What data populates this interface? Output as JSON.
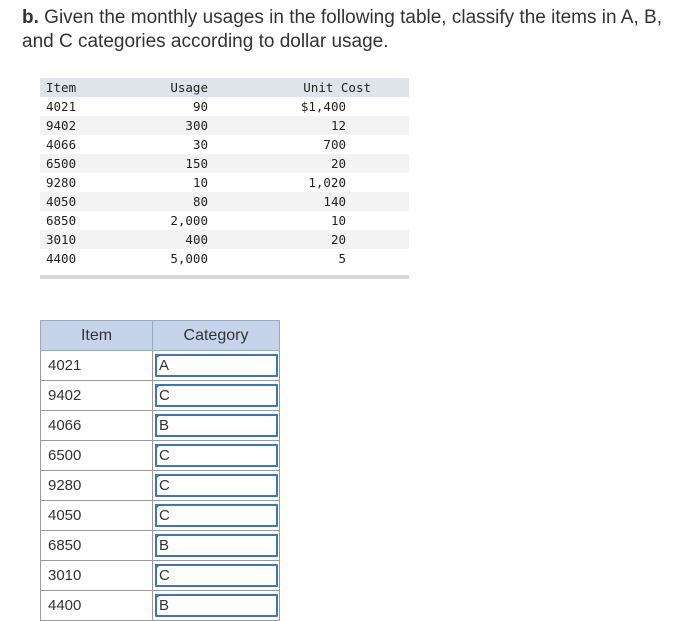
{
  "question": {
    "label": "b.",
    "text": "Given the monthly usages in the following table, classify the items in A, B, and C categories according to dollar usage."
  },
  "usage_table": {
    "headers": [
      "Item",
      "Usage",
      "Unit Cost"
    ],
    "rows": [
      [
        "4021",
        "90",
        "$1,400"
      ],
      [
        "9402",
        "300",
        "12"
      ],
      [
        "4066",
        "30",
        "700"
      ],
      [
        "6500",
        "150",
        "20"
      ],
      [
        "9280",
        "10",
        "1,020"
      ],
      [
        "4050",
        "80",
        "140"
      ],
      [
        "6850",
        "2,000",
        "10"
      ],
      [
        "3010",
        "400",
        "20"
      ],
      [
        "4400",
        "5,000",
        "5"
      ]
    ]
  },
  "category_table": {
    "headers": [
      "Item",
      "Category"
    ],
    "rows": [
      {
        "item": "4021",
        "category": "A"
      },
      {
        "item": "9402",
        "category": "C"
      },
      {
        "item": "4066",
        "category": "B"
      },
      {
        "item": "6500",
        "category": "C"
      },
      {
        "item": "9280",
        "category": "C"
      },
      {
        "item": "4050",
        "category": "C"
      },
      {
        "item": "6850",
        "category": "B"
      },
      {
        "item": "3010",
        "category": "C"
      },
      {
        "item": "4400",
        "category": "B"
      }
    ]
  },
  "colors": {
    "answer_border": "#3c74c4",
    "header_bg": "#c5d4ea",
    "usage_header_bg": "#dfe3ea"
  }
}
